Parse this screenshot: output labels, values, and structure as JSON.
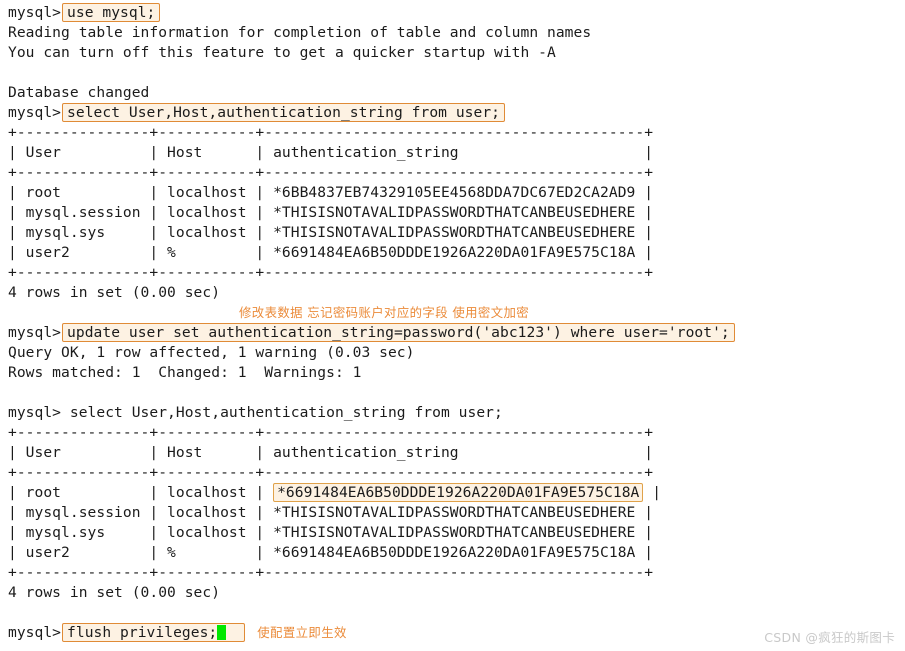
{
  "terminal": {
    "prompt": "mysql> ",
    "lines": [
      {
        "kind": "prompt-highlight",
        "prompt": "mysql>",
        "command": "use mysql;"
      },
      {
        "kind": "text",
        "text": "Reading table information for completion of table and column names"
      },
      {
        "kind": "text",
        "text": "You can turn off this feature to get a quicker startup with -A"
      },
      {
        "kind": "blank",
        "text": " "
      },
      {
        "kind": "text",
        "text": "Database changed"
      },
      {
        "kind": "prompt-highlight",
        "prompt": "mysql>",
        "command": "select User,Host,authentication_string from user;"
      },
      {
        "kind": "text",
        "text": "+---------------+-----------+-------------------------------------------+"
      },
      {
        "kind": "text",
        "text": "| User          | Host      | authentication_string                     |"
      },
      {
        "kind": "text",
        "text": "+---------------+-----------+-------------------------------------------+"
      },
      {
        "kind": "text",
        "text": "| root          | localhost | *6BB4837EB74329105EE4568DDA7DC67ED2CA2AD9 |"
      },
      {
        "kind": "text",
        "text": "| mysql.session | localhost | *THISISNOTAVALIDPASSWORDTHATCANBEUSEDHERE |"
      },
      {
        "kind": "text",
        "text": "| mysql.sys     | localhost | *THISISNOTAVALIDPASSWORDTHATCANBEUSEDHERE |"
      },
      {
        "kind": "text",
        "text": "| user2         | %         | *6691484EA6B50DDDE1926A220DA01FA9E575C18A |"
      },
      {
        "kind": "text",
        "text": "+---------------+-----------+-------------------------------------------+"
      },
      {
        "kind": "text",
        "text": "4 rows in set (0.00 sec)"
      },
      {
        "kind": "note",
        "text": "修改表数据 忘记密码账户对应的字段 使用密文加密"
      },
      {
        "kind": "prompt-highlight",
        "prompt": "mysql>",
        "command": "update user set authentication_string=password('abc123') where user='root';"
      },
      {
        "kind": "text",
        "text": "Query OK, 1 row affected, 1 warning (0.03 sec)"
      },
      {
        "kind": "text",
        "text": "Rows matched: 1  Changed: 1  Warnings: 1"
      },
      {
        "kind": "blank",
        "text": " "
      },
      {
        "kind": "text",
        "text": "mysql> select User,Host,authentication_string from user;"
      },
      {
        "kind": "text",
        "text": "+---------------+-----------+-------------------------------------------+"
      },
      {
        "kind": "text",
        "text": "| User          | Host      | authentication_string                     |"
      },
      {
        "kind": "text",
        "text": "+---------------+-----------+-------------------------------------------+"
      },
      {
        "kind": "cell-highlight",
        "prefix": "| root          | localhost | ",
        "cell": "*6691484EA6B50DDDE1926A220DA01FA9E575C18A",
        "suffix": " |"
      },
      {
        "kind": "text",
        "text": "| mysql.session | localhost | *THISISNOTAVALIDPASSWORDTHATCANBEUSEDHERE |"
      },
      {
        "kind": "text",
        "text": "| mysql.sys     | localhost | *THISISNOTAVALIDPASSWORDTHATCANBEUSEDHERE |"
      },
      {
        "kind": "text",
        "text": "| user2         | %         | *6691484EA6B50DDDE1926A220DA01FA9E575C18A |"
      },
      {
        "kind": "text",
        "text": "+---------------+-----------+-------------------------------------------+"
      },
      {
        "kind": "text",
        "text": "4 rows in set (0.00 sec)"
      },
      {
        "kind": "blank",
        "text": " "
      },
      {
        "kind": "prompt-highlight-cursor",
        "prompt": "mysql>",
        "command": "flush privileges;",
        "note": "使配置立即生效"
      }
    ]
  },
  "watermark": {
    "text": "CSDN @疯狂的斯图卡"
  },
  "colors": {
    "background": "#ffffff",
    "text": "#1b1b1b",
    "highlight_border": "#e08b36",
    "highlight_fill": "#fdf2e3",
    "annotation": "#eb8b3a",
    "cursor": "#00e800",
    "watermark": "#c9c9c9"
  }
}
